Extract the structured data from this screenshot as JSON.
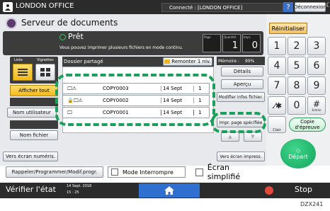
{
  "topbar": {
    "title": "LONDON OFFICE",
    "connection": "Connecté : [LONDON OFFICE]",
    "help": "?",
    "logout": "Déconnexion",
    "moon": "☾"
  },
  "header": {
    "app_title": "Serveur de documents",
    "status": "Prêt",
    "status_sub": "Vous pouvez imprimer plusieurs fichiers en mode continu.",
    "counter1_label": "Page",
    "counter1_value": "1",
    "counter2_label": "Quantité",
    "counter2_value": "1",
    "counter3_label": "Impr.",
    "counter3_value": "0"
  },
  "left": {
    "view_list": "Liste",
    "view_thumb": "Vignettes",
    "show_all": "Afficher tout",
    "user_name": "Nom utilisateur",
    "file_name": "Nom fichier",
    "to_digital": "Vers écran numéris."
  },
  "list": {
    "folder": "Dossier partagé",
    "up_level": "Remonter 1 niv.",
    "rows": [
      {
        "icons": "🖵⚠",
        "name": "COPY0003",
        "date": "14 Sept",
        "pages": "1"
      },
      {
        "icons": "🔒🖵⚠",
        "name": "COPY0002",
        "date": "14 Sept",
        "pages": "1"
      },
      {
        "icons": "🖵",
        "name": "COPY0001",
        "date": "14 Sept",
        "pages": "1"
      }
    ]
  },
  "right": {
    "memory": "Mémoire :",
    "memory_val": "99%",
    "details": "Détails",
    "preview": "Aperçu",
    "modify": "Modifier infos fichier.",
    "print_page": "Impr. page spécifiée",
    "up": "▲",
    "down": "▼",
    "to_print": "Vers écran impress."
  },
  "footer": {
    "recall": "Rappeler/Programmer/Modif.progr.",
    "interrupt": "Mode Interrompre",
    "simplified": "Écran simplifié"
  },
  "keypad": {
    "reset": "Réinitialiser",
    "keys": [
      "1",
      "2",
      "3",
      "4",
      "5",
      "6",
      "7",
      "8",
      "9",
      ".⁄✱",
      "0",
      "#"
    ],
    "enter": "Entrée",
    "clear": "Clair",
    "copy_label": "Copie d'épreuve",
    "start": "Départ"
  },
  "bottombar": {
    "check_status": "Vérifier l'état",
    "date": "14 Sept. 2018",
    "time": "15 : 25",
    "stop": "Stop"
  },
  "caption": "DZX241"
}
